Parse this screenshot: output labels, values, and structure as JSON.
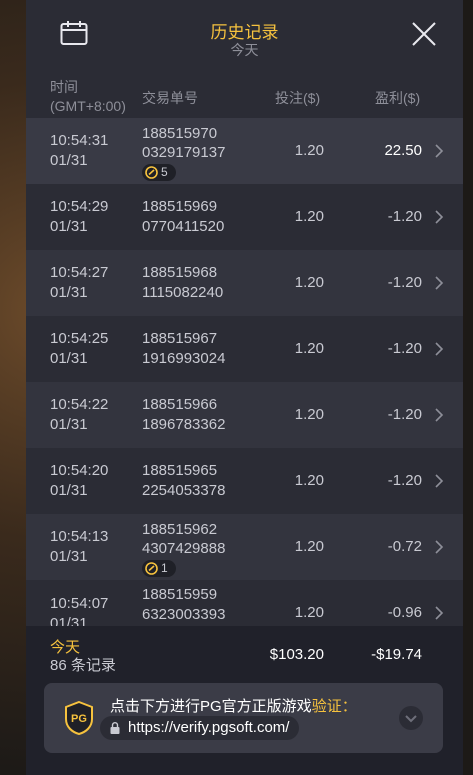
{
  "header": {
    "title": "历史记录",
    "subtitle": "今天"
  },
  "columns": {
    "time_line1": "时间",
    "time_line2": "(GMT+8:00)",
    "order": "交易单号",
    "bet": "投注($)",
    "profit": "盈利($)"
  },
  "rows": [
    {
      "time": "10:54:31",
      "date": "01/31",
      "id1": "188515970",
      "id2": "0329179137",
      "badge": "5",
      "bet": "1.20",
      "profit": "22.50"
    },
    {
      "time": "10:54:29",
      "date": "01/31",
      "id1": "188515969",
      "id2": "0770411520",
      "badge": "",
      "bet": "1.20",
      "profit": "-1.20"
    },
    {
      "time": "10:54:27",
      "date": "01/31",
      "id1": "188515968",
      "id2": "1115082240",
      "badge": "",
      "bet": "1.20",
      "profit": "-1.20"
    },
    {
      "time": "10:54:25",
      "date": "01/31",
      "id1": "188515967",
      "id2": "1916993024",
      "badge": "",
      "bet": "1.20",
      "profit": "-1.20"
    },
    {
      "time": "10:54:22",
      "date": "01/31",
      "id1": "188515966",
      "id2": "1896783362",
      "badge": "",
      "bet": "1.20",
      "profit": "-1.20"
    },
    {
      "time": "10:54:20",
      "date": "01/31",
      "id1": "188515965",
      "id2": "2254053378",
      "badge": "",
      "bet": "1.20",
      "profit": "-1.20"
    },
    {
      "time": "10:54:13",
      "date": "01/31",
      "id1": "188515962",
      "id2": "4307429888",
      "badge": "1",
      "bet": "1.20",
      "profit": "-0.72"
    },
    {
      "time": "10:54:07",
      "date": "01/31",
      "id1": "188515959",
      "id2": "6323003393",
      "badge": "",
      "bet": "1.20",
      "profit": "-0.96"
    }
  ],
  "footer": {
    "today": "今天",
    "count": "86 条记录",
    "total_bet": "$103.20",
    "total_profit": "-$19.74"
  },
  "verify": {
    "text": "点击下方进行PG官方正版游戏",
    "highlight": "验证：",
    "url": "https://verify.pgsoft.com/",
    "logo_text": "PG"
  },
  "colors": {
    "accent": "#f6c23e",
    "panel": "#2b2c35",
    "row_alt": "#33343e"
  },
  "icons": {
    "calendar": "calendar-icon",
    "close": "close-icon",
    "chevron": "chevron-right-icon",
    "lock": "lock-icon",
    "expand": "chevron-down-icon"
  }
}
